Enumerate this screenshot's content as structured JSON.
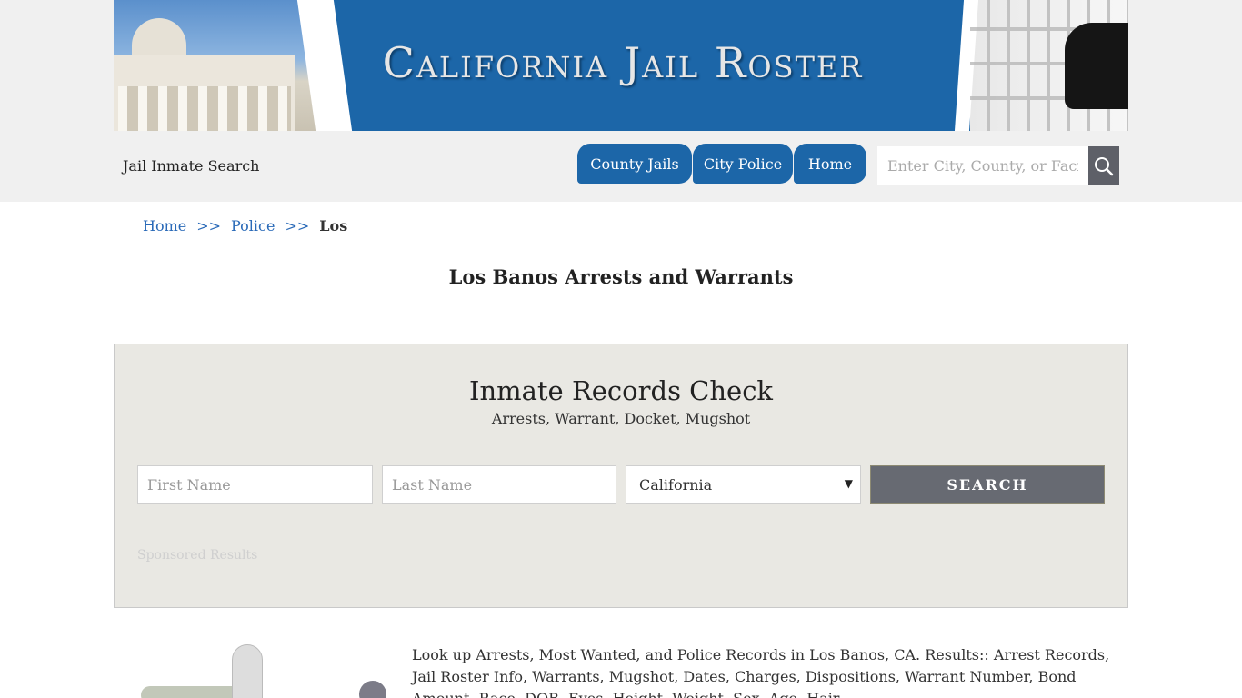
{
  "header": {
    "banner_title": "California Jail Roster",
    "tagline": "Jail Inmate Search",
    "nav": {
      "county": "County Jails",
      "city": "City Police",
      "home": "Home"
    },
    "search": {
      "placeholder": "Enter City, County, or Facility"
    },
    "accent": "#1c66a8"
  },
  "breadcrumb": {
    "home": "Home",
    "sep": ">>",
    "police": "Police",
    "current": "Los"
  },
  "page": {
    "title": "Los Banos Arrests and Warrants"
  },
  "records": {
    "title": "Inmate Records Check",
    "subtitle": "Arrests, Warrant, Docket, Mugshot",
    "first_placeholder": "First Name",
    "last_placeholder": "Last Name",
    "state_selected": "California",
    "submit": "SEARCH",
    "sponsored": "Sponsored Results"
  },
  "content": {
    "description": "Look up Arrests, Most Wanted, and Police Records in Los Banos, CA. Results:: Arrest Records, Jail Roster Info, Warrants, Mugshot, Dates, Charges, Dispositions, Warrant Number, Bond Amount, Race, DOB, Eyes, Height, Weight, Sex, Age, Hair"
  }
}
